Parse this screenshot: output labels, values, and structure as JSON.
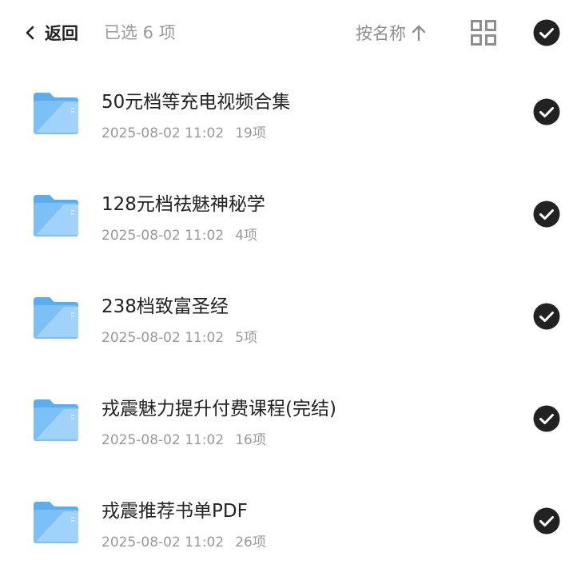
{
  "header": {
    "back_label": "返回",
    "selected_text": "已选 6 项",
    "sort_label": "按名称",
    "sort_icon": "arrow-up-icon",
    "view_icon": "grid-view-icon",
    "select_all_icon": "check-circle-icon"
  },
  "files": [
    {
      "name": "50元档等充电视频合集",
      "date": "2025-08-02 11:02",
      "count": "19项",
      "selected": true
    },
    {
      "name": "128元档祛魅神秘学",
      "date": "2025-08-02 11:02",
      "count": "4项",
      "selected": true
    },
    {
      "name": "238档致富圣经",
      "date": "2025-08-02 11:02",
      "count": "5项",
      "selected": true
    },
    {
      "name": "戎震魅力提升付费课程(完结)",
      "date": "2025-08-02 11:02",
      "count": "16项",
      "selected": true
    },
    {
      "name": "戎震推荐书单PDF",
      "date": "2025-08-02 11:02",
      "count": "26项",
      "selected": true
    }
  ],
  "colors": {
    "folder_light": "#bfe0fb",
    "folder_main": "#7cc0f5",
    "folder_tab": "#5aaef0",
    "check_bg": "#222222"
  }
}
